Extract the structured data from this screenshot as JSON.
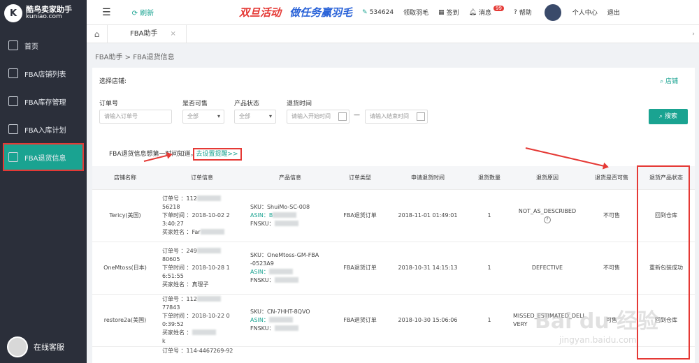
{
  "app": {
    "brand_line1": "酷鸟卖家助手",
    "brand_line2": "kuniao.com"
  },
  "sidebar": {
    "items": [
      {
        "label": "首页",
        "icon": "home-icon"
      },
      {
        "label": "FBA店铺列表",
        "icon": "shop-list-icon"
      },
      {
        "label": "FBA库存管理",
        "icon": "inventory-icon"
      },
      {
        "label": "FBA入库计划",
        "icon": "inbound-icon"
      },
      {
        "label": "FBA退货信息",
        "icon": "return-icon"
      }
    ],
    "support": "在线客服"
  },
  "topbar": {
    "refresh": "刷新",
    "promo1": "双旦活动",
    "promo2": "做任务赢羽毛",
    "points": "534624",
    "get_feather": "领取羽毛",
    "checkin": "签到",
    "messages": "消息",
    "msg_count": "99",
    "help": "帮助",
    "user_center": "个人中心",
    "logout": "退出"
  },
  "tabs": [
    {
      "label": "FBA助手"
    }
  ],
  "breadcrumb": "FBA助手 > FBA退货信息",
  "filters": {
    "store_label": "选择店铺:",
    "shop_link": "店铺",
    "order_label": "订单号",
    "order_placeholder": "请输入订单号",
    "sellable_label": "是否可售",
    "sellable_value": "全部",
    "status_label": "产品状态",
    "status_value": "全部",
    "time_label": "退货时间",
    "start_placeholder": "请输入开始时间",
    "end_placeholder": "请输入结束时间",
    "search": "搜索"
  },
  "notice": {
    "text": "FBA退货信息想第一时间知道，",
    "link": "去设置提醒>>"
  },
  "table": {
    "headers": [
      "店铺名称",
      "订单信息",
      "产品信息",
      "订单类型",
      "申请退货时间",
      "退货数量",
      "退货原因",
      "退货是否可售",
      "退货产品状态"
    ],
    "rows": [
      {
        "store": "Tericy(美国)",
        "order_no": "订单号 ：112",
        "order_no2": "56218",
        "order_time": "下单时间 ：2018-10-02 2",
        "order_time2": "3:40:27",
        "buyer": "买家姓名 ：Far",
        "sku": "SKU：ShuiMo-SC-008",
        "asin": "ASIN：B",
        "fnsku": "FNSKU：",
        "type": "FBA退货订单",
        "time": "2018-11-01 01:49:01",
        "qty": "1",
        "reason": "NOT_AS_DESCRIBED",
        "sellable": "不可售",
        "status": "回到仓库"
      },
      {
        "store": "OneMtoss(日本)",
        "order_no": "订单号 ：249",
        "order_no2": "80605",
        "order_time": "下单时间 ：2018-10-28 1",
        "order_time2": "6:51:55",
        "buyer": "买家姓名 ：真理子",
        "sku": "SKU：OneMtoss-GM-FBA",
        "sku2": "-0523A9",
        "asin": "ASIN：",
        "fnsku": "FNSKU：",
        "type": "FBA退货订单",
        "time": "2018-10-31 14:15:13",
        "qty": "1",
        "reason": "DEFECTIVE",
        "sellable": "不可售",
        "status": "重新包装成功"
      },
      {
        "store": "restore2a(美国)",
        "order_no": "订单号 ：112",
        "order_no2": "77843",
        "order_time": "下单时间 ：2018-10-22 0",
        "order_time2": "0:39:52",
        "buyer": "买家姓名 ：",
        "buyer2": "k",
        "sku": "SKU：CN-7HHT-8QVO",
        "asin": "ASIN：",
        "fnsku": "FNSKU：",
        "type": "FBA退货订单",
        "time": "2018-10-30 15:06:06",
        "qty": "1",
        "reason": "MISSED_ESTIMATED_DELI",
        "reason2": "VERY",
        "sellable": "可售",
        "status": "回到仓库"
      },
      {
        "order_no": "订单号 ：114-4467269-92"
      }
    ]
  },
  "watermark": {
    "main": "Bai du 经验",
    "sub": "jingyan.baidu.com"
  },
  "colors": {
    "accent": "#1aa391",
    "sidebar": "#2b2f3a",
    "highlight": "#e53935"
  }
}
